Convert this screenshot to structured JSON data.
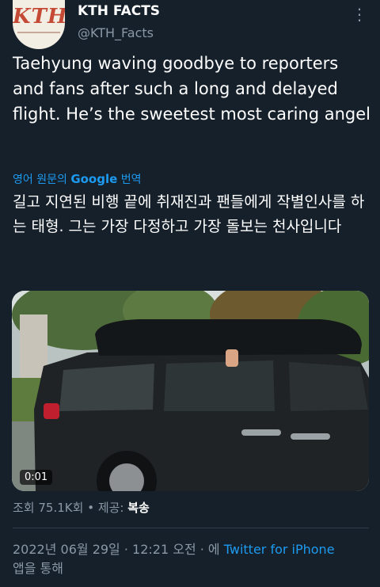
{
  "author": {
    "avatar_text": "KTH",
    "name": "KTH FACTS",
    "handle": "@KTH_Facts"
  },
  "tweet": {
    "text": "Taehyung waving goodbye to reporters and fans after such a long and delayed flight. He’s the sweetest most caring angel",
    "translate_prefix": "영어 원문의 ",
    "translate_brand": "Google",
    "translate_suffix": " 번역",
    "translated_text": "길고 지연된 비행 끝에 취재진과 팬들에게 작별인사를 하는 태형. 그는 가장 다정하고 가장 돌보는 천사입니다"
  },
  "media": {
    "duration": "0:01"
  },
  "stats": {
    "views_label": "조회 ",
    "views_count": "75.1K회",
    "separator": " • ",
    "source_label": "제공: ",
    "source_value": "복송"
  },
  "meta": {
    "timestamp": "2022년 06월 29일 · 12:21 오전 · 에 ",
    "app": "Twitter for iPhone",
    "app_suffix": "앱을 통해"
  },
  "icons": {
    "more": "more-icon"
  },
  "colors": {
    "background": "#15202b",
    "accent": "#1d9bf0",
    "secondary_text": "#8b98a5"
  }
}
